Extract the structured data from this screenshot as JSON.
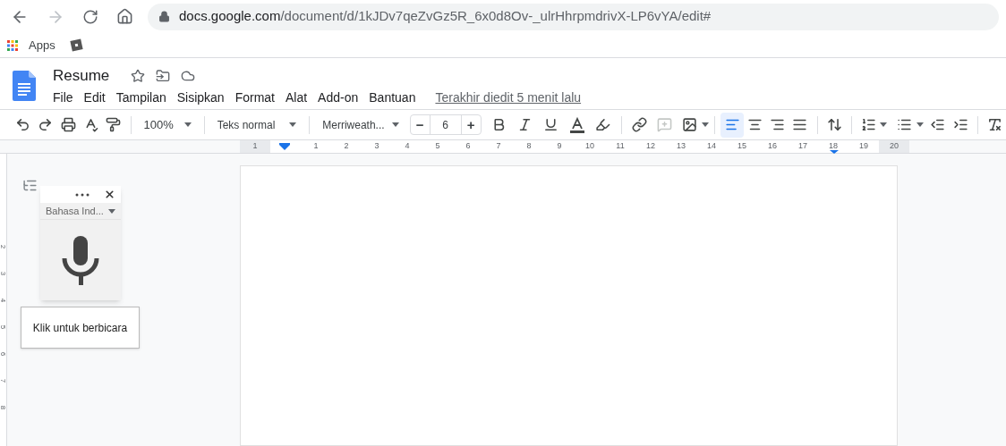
{
  "browser": {
    "url_host": "docs.google.com",
    "url_path": "/document/d/1kJDv7qeZvGz5R_6x0d8Ov-_ulrHhrpmdrivX-LP6vYA/edit#",
    "bookmarks": [
      {
        "label": "Apps"
      }
    ]
  },
  "document": {
    "title": "Resume",
    "menu": [
      "File",
      "Edit",
      "Tampilan",
      "Sisipkan",
      "Format",
      "Alat",
      "Add-on",
      "Bantuan"
    ],
    "last_edit": "Terakhir diedit 5 menit lalu"
  },
  "toolbar": {
    "zoom": "100%",
    "style": "Teks normal",
    "font": "Merriweath...",
    "font_size": "6",
    "decrease": "−",
    "increase": "+",
    "insert": [
      {
        "kind": "link",
        "disabled": false
      },
      {
        "kind": "comment",
        "disabled": true
      },
      {
        "kind": "image",
        "disabled": false
      }
    ],
    "alignment": [
      {
        "kind": "left",
        "selected": true
      },
      {
        "kind": "center",
        "selected": false
      },
      {
        "kind": "right",
        "selected": false
      },
      {
        "kind": "justify",
        "selected": false
      }
    ]
  },
  "ruler": {
    "labels": [
      "1",
      "1",
      "2",
      "3",
      "4",
      "5",
      "6",
      "7",
      "8",
      "9",
      "10",
      "11",
      "12",
      "13",
      "14",
      "15",
      "16",
      "17",
      "18",
      "19",
      "20"
    ],
    "vertical_labels": [
      "2",
      "3",
      "4",
      "5",
      "6",
      "7",
      "8"
    ]
  },
  "voice_typing": {
    "language": "Bahasa Ind...",
    "tooltip": "Klik untuk berbicara"
  }
}
